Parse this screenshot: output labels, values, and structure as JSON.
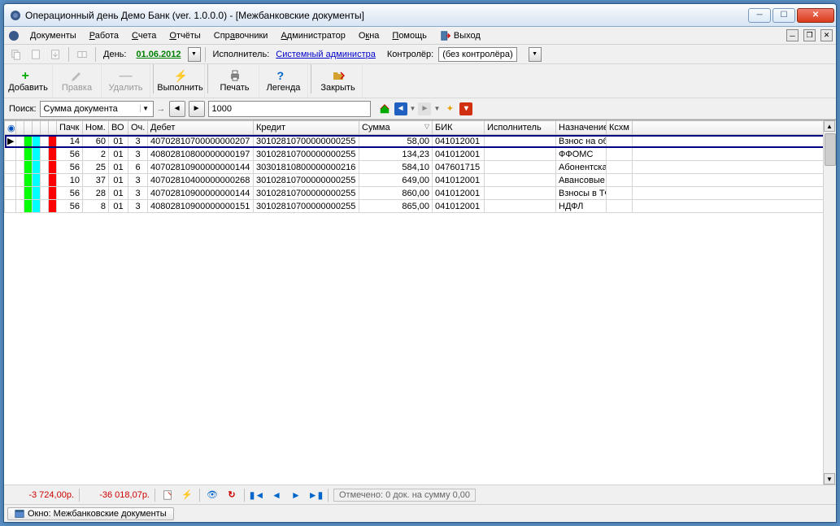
{
  "title": "Операционный день Демо Банк (ver. 1.0.0.0) - [Межбанковские документы]",
  "menu": {
    "docs": "Документы",
    "work": "Работа",
    "accounts": "Счета",
    "reports": "Отчёты",
    "refs": "Справочники",
    "admin": "Администратор",
    "windows": "Окна",
    "help": "Помощь",
    "exit": "Выход"
  },
  "toolbar1": {
    "day_label": "День:",
    "date": "01.06.2012",
    "executor_label": "Исполнитель:",
    "executor_value": "Системный администра",
    "controller_label": "Контролёр:",
    "controller_value": "(без контролёра)"
  },
  "bigbtns": {
    "add": "Добавить",
    "edit": "Правка",
    "del": "Удалить",
    "exec": "Выполнить",
    "print": "Печать",
    "legend": "Легенда",
    "close": "Закрыть"
  },
  "search": {
    "label": "Поиск:",
    "field": "Сумма документа",
    "value": "1000"
  },
  "columns": {
    "pack": "Пачк",
    "num": "Ном.",
    "vo": "ВО",
    "och": "Оч.",
    "debit": "Дебет",
    "credit": "Кредит",
    "sum": "Сумма",
    "bik": "БИК",
    "exec": "Исполнитель",
    "purpose": "Назначение",
    "ksxm": "Ксхм"
  },
  "rows": [
    {
      "sel": true,
      "c1": "#00ff00",
      "c2": "#00ffff",
      "c3": "#ff0000",
      "pack": "14",
      "num": "60",
      "vo": "01",
      "och": "3",
      "debit": "40702810700000000207",
      "credit": "30102810700000000255",
      "sum": "58,00",
      "bik": "041012001",
      "exec": "",
      "purpose": "Взнос на об"
    },
    {
      "c1": "#00ff00",
      "c2": "#00ffff",
      "c3": "#ff0000",
      "pack": "56",
      "num": "2",
      "vo": "01",
      "och": "3",
      "debit": "40802810800000000197",
      "credit": "30102810700000000255",
      "sum": "134,23",
      "bik": "041012001",
      "exec": "",
      "purpose": "ФФОМС"
    },
    {
      "c1": "#00ff00",
      "c2": "#00ffff",
      "c3": "#ff0000",
      "pack": "56",
      "num": "25",
      "vo": "01",
      "och": "6",
      "debit": "40702810900000000144",
      "credit": "30301810800000000216",
      "sum": "584,10",
      "bik": "047601715",
      "exec": "",
      "purpose": "Абонентска"
    },
    {
      "c1": "#00ff00",
      "c2": "#00ffff",
      "c3": "#ff0000",
      "pack": "10",
      "num": "37",
      "vo": "01",
      "och": "3",
      "debit": "40702810400000000268",
      "credit": "30102810700000000255",
      "sum": "649,00",
      "bik": "041012001",
      "exec": "",
      "purpose": "Авансовые"
    },
    {
      "c1": "#00ff00",
      "c2": "#00ffff",
      "c3": "#ff0000",
      "pack": "56",
      "num": "28",
      "vo": "01",
      "och": "3",
      "debit": "40702810900000000144",
      "credit": "30102810700000000255",
      "sum": "860,00",
      "bik": "041012001",
      "exec": "",
      "purpose": "Взносы в ТФ"
    },
    {
      "c1": "#00ff00",
      "c2": "#00ffff",
      "c3": "#ff0000",
      "pack": "56",
      "num": "8",
      "vo": "01",
      "och": "3",
      "debit": "40802810900000000151",
      "credit": "30102810700000000255",
      "sum": "865,00",
      "bik": "041012001",
      "exec": "",
      "purpose": "НДФЛ"
    }
  ],
  "status": {
    "sum1": "-3 724,00р.",
    "sum2": "-36 018,07р.",
    "marked": "Отмечено: 0 док. на сумму 0,00"
  },
  "bottom_tab": "Окно: Межбанковские документы"
}
